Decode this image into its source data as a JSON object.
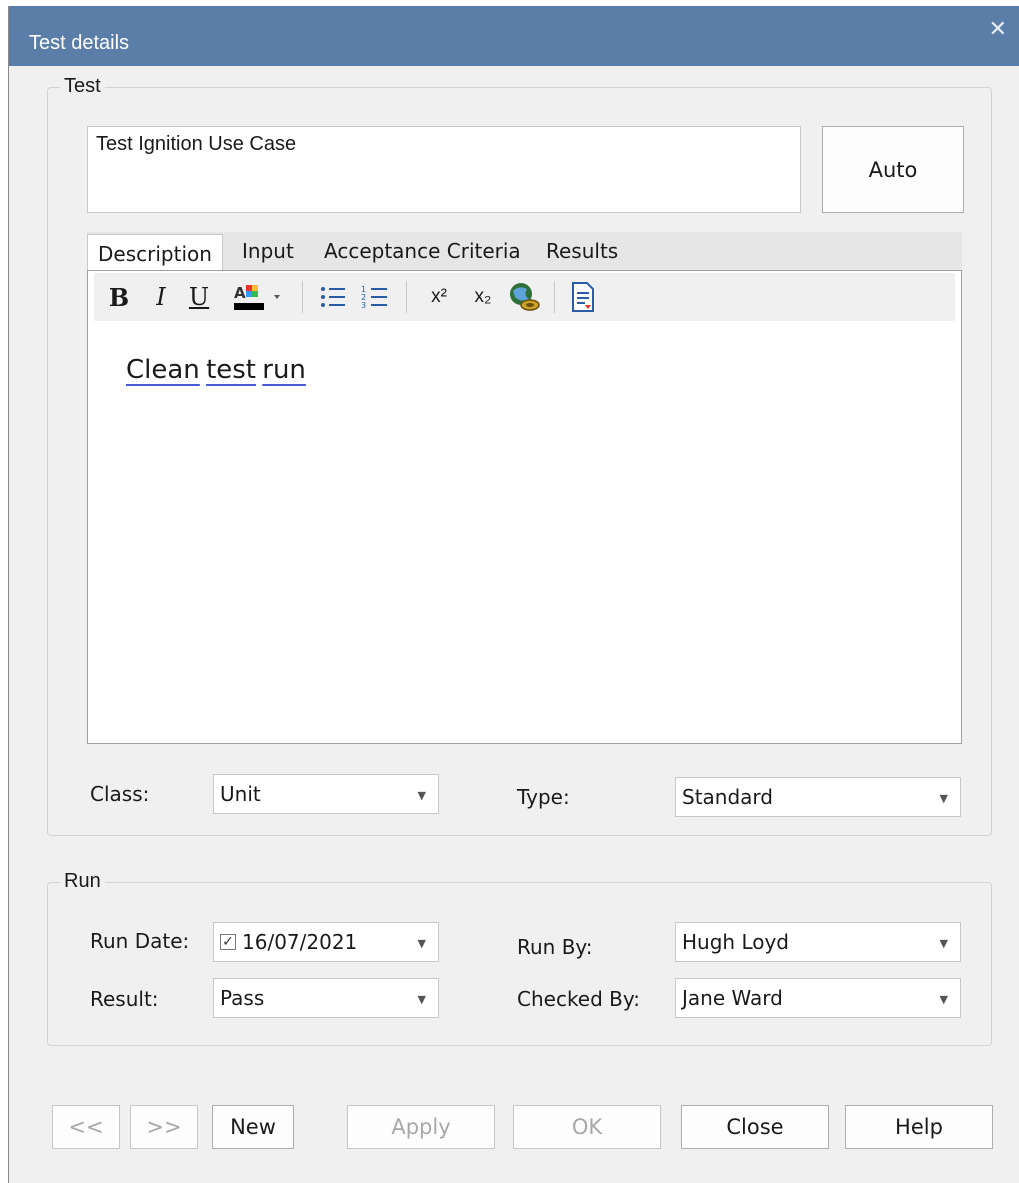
{
  "window": {
    "title": "Test details",
    "close_icon": "close-icon"
  },
  "test_group": {
    "legend": "Test",
    "name_value": "Test  Ignition Use Case",
    "auto_label": "Auto",
    "tabs": [
      {
        "label": "Description",
        "active": true
      },
      {
        "label": "Input",
        "active": false
      },
      {
        "label": "Acceptance Criteria",
        "active": false
      },
      {
        "label": "Results",
        "active": false
      }
    ],
    "toolbar": {
      "bold": "B",
      "italic": "I",
      "underline": "U",
      "font_color_icon": "font-color-icon",
      "bullet_list_icon": "bullet-list-icon",
      "numbered_list_icon": "numbered-list-icon",
      "superscript": "x²",
      "subscript": "x₂",
      "hyperlink_icon": "globe-link-icon",
      "document_icon": "document-icon"
    },
    "editor_words": [
      "Clean",
      "test",
      "run"
    ],
    "class_label": "Class:",
    "class_value": "Unit",
    "type_label": "Type:",
    "type_value": "Standard"
  },
  "run_group": {
    "legend": "Run",
    "run_date_label": "Run Date:",
    "run_date_value": "16/07/2021",
    "run_date_checked": true,
    "run_by_label": "Run By:",
    "run_by_value": "Hugh Loyd",
    "result_label": "Result:",
    "result_value": "Pass",
    "checked_by_label": "Checked By:",
    "checked_by_value": "Jane Ward"
  },
  "buttons": {
    "prev": "<<",
    "next": ">>",
    "new": "New",
    "apply": "Apply",
    "ok": "OK",
    "close": "Close",
    "help": "Help"
  },
  "colors": {
    "titlebar": "#5a7ea8",
    "dialog_bg": "#f0f0f0",
    "spell_underline": "#4a5bd6"
  }
}
